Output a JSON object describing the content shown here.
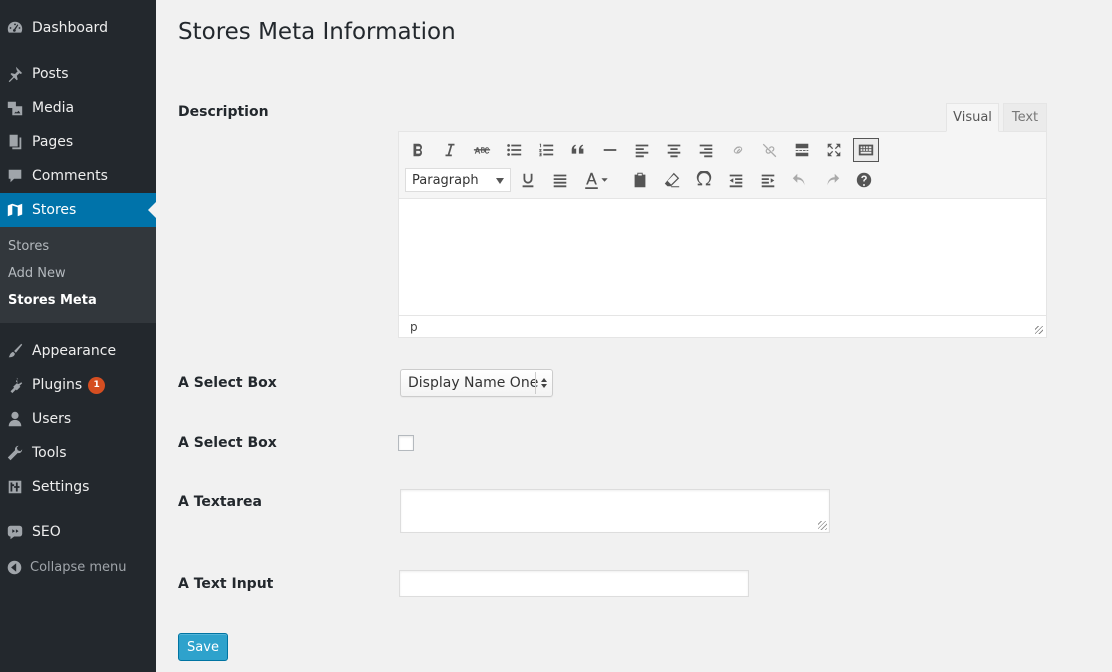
{
  "sidebar": {
    "items": [
      {
        "label": "Dashboard",
        "icon": "dashboard-icon"
      },
      {
        "label": "Posts",
        "icon": "pin-icon"
      },
      {
        "label": "Media",
        "icon": "media-icon"
      },
      {
        "label": "Pages",
        "icon": "pages-icon"
      },
      {
        "label": "Comments",
        "icon": "comment-icon"
      },
      {
        "label": "Stores",
        "icon": "map-icon",
        "active": true
      },
      {
        "label": "Appearance",
        "icon": "brush-icon"
      },
      {
        "label": "Plugins",
        "icon": "plug-icon",
        "badge": "1"
      },
      {
        "label": "Users",
        "icon": "user-icon"
      },
      {
        "label": "Tools",
        "icon": "wrench-icon"
      },
      {
        "label": "Settings",
        "icon": "settings-icon"
      },
      {
        "label": "SEO",
        "icon": "seo-icon"
      }
    ],
    "submenu": [
      {
        "label": "Stores"
      },
      {
        "label": "Add New"
      },
      {
        "label": "Stores Meta",
        "current": true
      }
    ],
    "collapse_label": "Collapse menu"
  },
  "page": {
    "title": "Stores Meta Information"
  },
  "form": {
    "description_label": "Description",
    "editor": {
      "tab_visual": "Visual",
      "tab_text": "Text",
      "format_value": "Paragraph",
      "path": "p"
    },
    "select_label": "A Select Box",
    "select_value": "Display Name One",
    "checkbox_label": "A Select Box",
    "textarea_label": "A Textarea",
    "text_input_label": "A Text Input",
    "save_label": "Save"
  },
  "colors": {
    "sidebar_bg": "#23282d",
    "active_bg": "#0073aa",
    "badge": "#d54e21",
    "button": "#2ea2cc"
  }
}
